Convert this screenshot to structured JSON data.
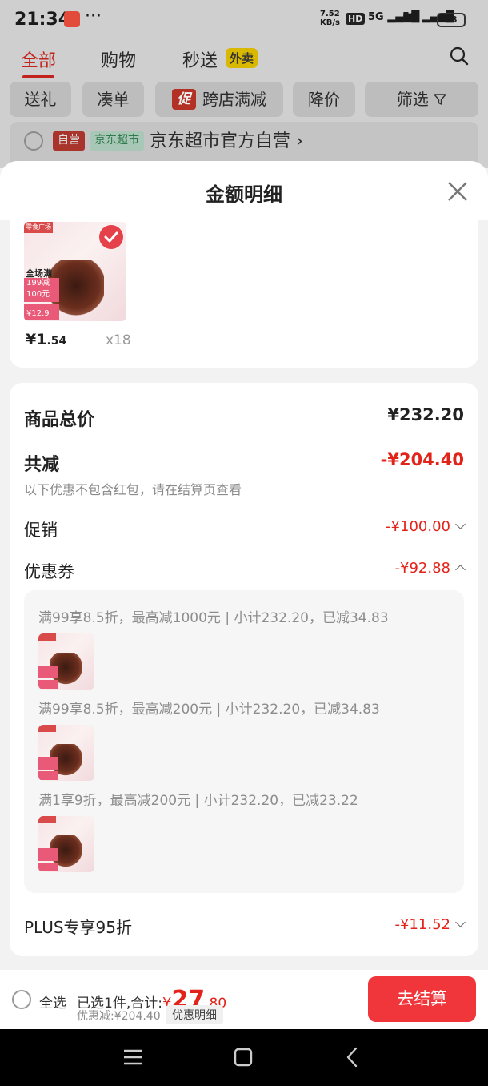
{
  "status_bar": {
    "time": "21:34",
    "more": "···",
    "net_speed_top": "7.52",
    "net_speed_bottom": "KB/s",
    "hd": "HD",
    "sig1": "5G",
    "sig2": "5G",
    "battery": "53"
  },
  "header": {
    "tabs": [
      {
        "label": "全部"
      },
      {
        "label": "购物"
      },
      {
        "label": "秒送"
      }
    ],
    "takeout_badge": "外卖",
    "chips": [
      {
        "label": "送礼"
      },
      {
        "label": "凑单"
      },
      {
        "label": "跨店满减",
        "badge": "促"
      },
      {
        "label": "降价"
      },
      {
        "label": "筛选"
      }
    ],
    "store": {
      "tag_self": "自营",
      "tag_supermarket": "京东超市",
      "name": "京东超市官方自营 ›"
    }
  },
  "sheet": {
    "title": "金额明细",
    "item": {
      "price_prefix": "¥1",
      "price_decimal": ".54",
      "quantity": "x18",
      "thumb_text": {
        "brand": "零食广场",
        "line1": "全场满",
        "line2": "199减",
        "line3": "100元",
        "price": "¥12.9"
      }
    },
    "summary": {
      "goods_total_label": "商品总价",
      "goods_total_value": "¥232.20",
      "total_discount_label": "共减",
      "total_discount_value": "-¥204.40",
      "note": "以下优惠不包含红包，请在结算页查看",
      "promo_label": "促销",
      "promo_value": "-¥100.00",
      "coupon_label": "优惠券",
      "coupon_value": "-¥92.88",
      "coupons": [
        {
          "text": "满99享8.5折，最高减1000元 | 小计232.20，已减34.83"
        },
        {
          "text": "满99享8.5折，最高减200元 | 小计232.20，已减34.83"
        },
        {
          "text": "满1享9折，最高减200元 | 小计232.20，已减23.22"
        }
      ],
      "plus_label": "PLUS专享95折",
      "plus_value": "-¥11.52"
    }
  },
  "bottom_bar": {
    "select_all": "全选",
    "selected_text": "已选1件,合计:",
    "currency": "¥",
    "total_int": "27",
    "total_dec": ".80",
    "saved_text": "优惠减:¥204.40",
    "detail_button": "优惠明细",
    "checkout_button": "去结算"
  },
  "colors": {
    "accent_red": "#e2231a",
    "checkout_red": "#f0353b"
  }
}
